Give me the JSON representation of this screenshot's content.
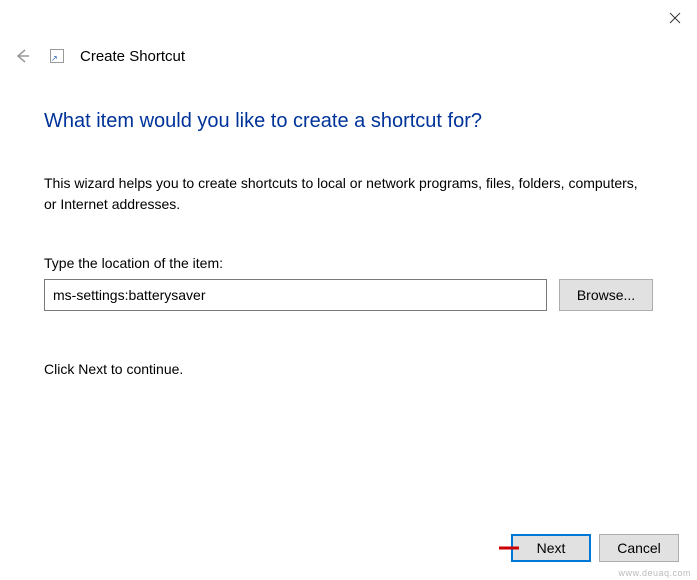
{
  "window": {
    "title": "Create Shortcut"
  },
  "main": {
    "heading": "What item would you like to create a shortcut for?",
    "description": "This wizard helps you to create shortcuts to local or network programs, files, folders, computers, or Internet addresses.",
    "field_label": "Type the location of the item:",
    "location_value": "ms-settings:batterysaver",
    "browse_label": "Browse...",
    "continue_text": "Click Next to continue."
  },
  "footer": {
    "next_label": "Next",
    "cancel_label": "Cancel"
  },
  "watermark": "www.deuaq.com"
}
